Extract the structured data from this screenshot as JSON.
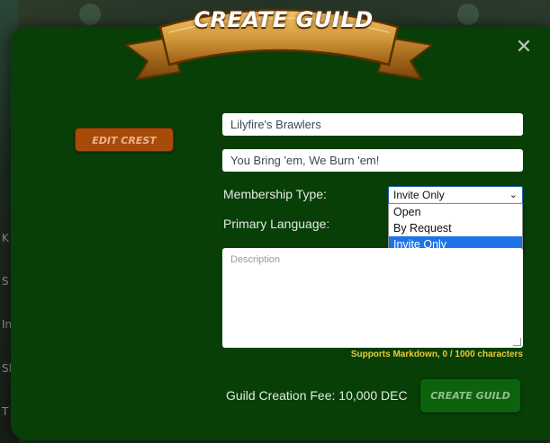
{
  "background": {
    "side_letters": [
      "K",
      "S",
      "In",
      "Sl",
      "T"
    ]
  },
  "modal": {
    "title": "CREATE GUILD",
    "close_symbol": "✕",
    "edit_crest_label": "EDIT CREST",
    "guild_name": {
      "value": "Lilyfire's Brawlers"
    },
    "motto": {
      "value": "You Bring 'em, We Burn 'em!"
    },
    "membership": {
      "label": "Membership Type:",
      "selected": "Invite Only",
      "options": [
        "Open",
        "By Request",
        "Invite Only"
      ]
    },
    "language": {
      "label": "Primary Language:"
    },
    "description": {
      "placeholder": "Description",
      "hint": "Supports Markdown, 0 / 1000 characters"
    },
    "fee_text": "Guild Creation Fee: 10,000 DEC",
    "create_label": "CREATE GUILD"
  },
  "colors": {
    "modal_bg": "#073f07",
    "banner_gold": "#d49a3a",
    "edit_crest": "#a74b0a",
    "create_button": "#0d620d",
    "hint": "#e8c93c",
    "select_highlight": "#1e73e8"
  },
  "icons": {
    "close": "close-icon",
    "chevron": "chevron-down-icon",
    "banner": "ribbon-banner-icon"
  }
}
